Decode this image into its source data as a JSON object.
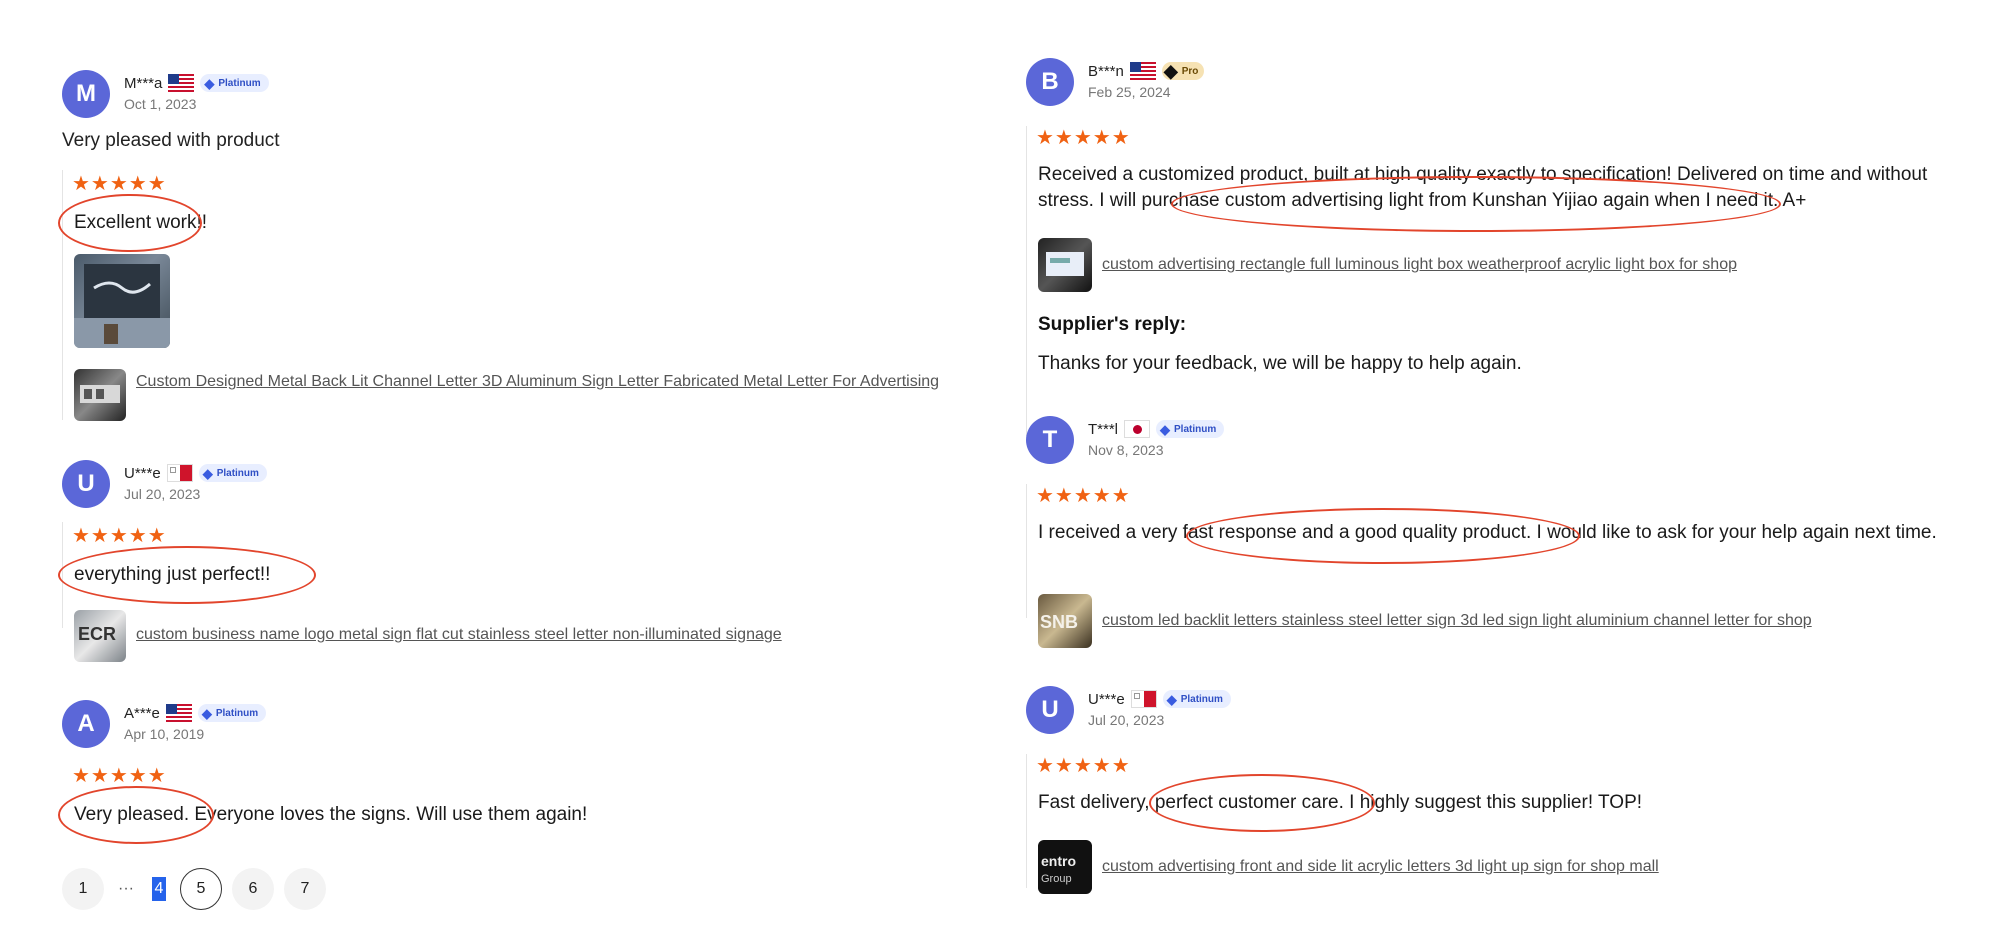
{
  "colors": {
    "avatar": "#5b67d8",
    "stars": "#f06213",
    "annotation_circle": "#e2452c",
    "badge_bg": "#e8eeff"
  },
  "left_reviews": [
    {
      "initial": "M",
      "name": "M***a",
      "flag": "us",
      "badge": "Platinum",
      "date": "Oct 1, 2023",
      "title": "Very pleased with product",
      "stars": "★★★★★",
      "text": "Excellent work!!",
      "product": "Custom Designed Metal Back Lit Channel Letter 3D Aluminum Sign Letter Fabricated Metal Letter For Advertising"
    },
    {
      "initial": "U",
      "name": "U***e",
      "flag": "mt",
      "badge": "Platinum",
      "date": "Jul 20, 2023",
      "stars": "★★★★★",
      "text": "everything just perfect!!",
      "product": "custom business name logo metal sign flat cut stainless steel letter non-illuminated signage"
    },
    {
      "initial": "A",
      "name": "A***e",
      "flag": "us",
      "badge": "Platinum",
      "date": "Apr 10, 2019",
      "stars": "★★★★★",
      "text": "Very pleased. Everyone loves the signs. Will use them again!"
    }
  ],
  "right_reviews": [
    {
      "initial": "B",
      "name": "B***n",
      "flag": "us",
      "badge": "Pro",
      "date": "Feb 25, 2024",
      "stars": "★★★★★",
      "text": "Received a customized product, built at high quality exactly to specification! Delivered on time and without stress. I will purchase custom advertising light from Kunshan Yijiao again when I need it. A+",
      "product": "custom advertising rectangle full luminous light box weatherproof acrylic light box for shop",
      "reply_label": "Supplier's reply:",
      "reply_text": "Thanks for your feedback, we will be happy to help again."
    },
    {
      "initial": "T",
      "name": "T***l",
      "flag": "jp",
      "badge": "Platinum",
      "date": "Nov 8, 2023",
      "stars": "★★★★★",
      "text": "I received a very fast response and a good quality product. I would like to ask for your help again next time.",
      "product": "custom led backlit letters stainless steel letter sign 3d led sign light aluminium channel letter for shop"
    },
    {
      "initial": "U",
      "name": "U***e",
      "flag": "mt",
      "badge": "Platinum",
      "date": "Jul 20, 2023",
      "stars": "★★★★★",
      "text": "Fast delivery, perfect customer care. I highly suggest this supplier! TOP!",
      "product": "custom advertising front and side lit acrylic letters 3d light up sign for shop mall"
    }
  ],
  "pagination": {
    "p1": "1",
    "ellipsis": "···",
    "p4": "4",
    "p5": "5",
    "p6": "6",
    "p7": "7"
  }
}
